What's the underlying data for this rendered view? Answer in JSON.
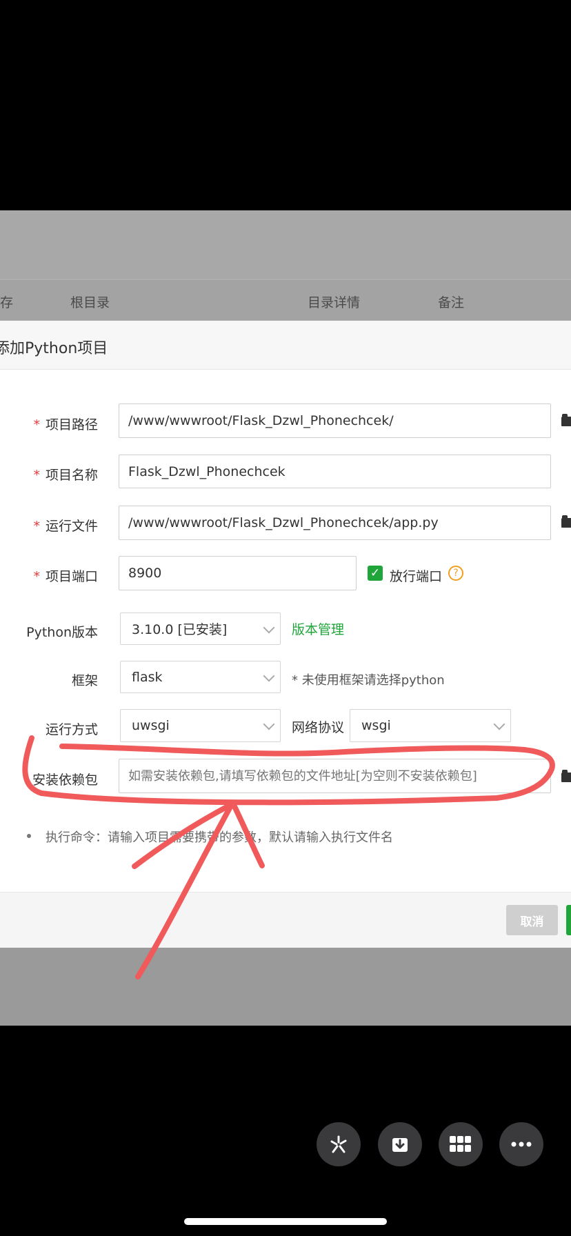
{
  "table_header": {
    "col1": "存",
    "col2": "根目录",
    "col3": "目录详情",
    "col4": "备注"
  },
  "dialog": {
    "title": "添加Python项目",
    "fields": {
      "project_path": {
        "label": "项目路径",
        "value": "/www/wwwroot/Flask_Dzwl_Phonechcek/"
      },
      "project_name": {
        "label": "项目名称",
        "value": "Flask_Dzwl_Phonechcek"
      },
      "run_file": {
        "label": "运行文件",
        "value": "/www/wwwroot/Flask_Dzwl_Phonechcek/app.py"
      },
      "project_port": {
        "label": "项目端口",
        "value": "8900",
        "open_port_label": "放行端口",
        "open_port_checked": true,
        "help": "?"
      },
      "python_version": {
        "label": "Python版本",
        "value": "3.10.0 [已安装]",
        "manage_link": "版本管理"
      },
      "framework": {
        "label": "框架",
        "value": "flask",
        "hint": "* 未使用框架请选择python"
      },
      "run_mode": {
        "label": "运行方式",
        "value": "uwsgi"
      },
      "network_protocol": {
        "label": "网络协议",
        "value": "wsgi"
      },
      "dependencies": {
        "label": "安装依赖包",
        "placeholder": "如需安装依赖包,请填写依赖包的文件地址[为空则不安装依赖包]"
      }
    },
    "required_mark": "*",
    "note": "执行命令：请输入项目需要携带的参数，默认请输入执行文件名",
    "cancel_button": "取消"
  },
  "annotation_color": "#f05a5a",
  "toolbar": {
    "icons": [
      "sparkle-icon",
      "save-icon",
      "grid-icon",
      "more-icon"
    ]
  }
}
